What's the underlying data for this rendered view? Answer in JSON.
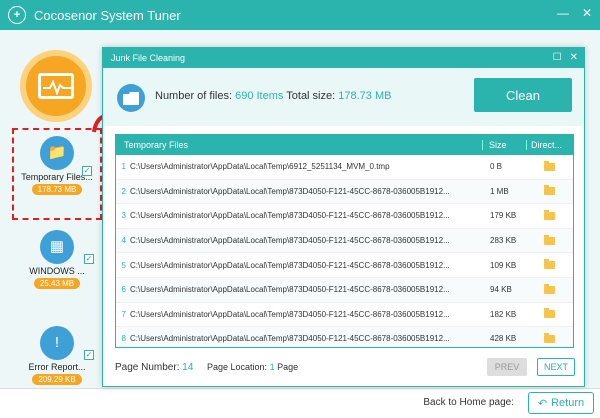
{
  "app": {
    "title": "Cocosenor System Tuner",
    "controls": [
      "minimize",
      "close"
    ]
  },
  "modules": [
    {
      "label": "Temporary Files...",
      "size": "178.73 MB",
      "selected": true,
      "icon": "folder-gear-icon"
    },
    {
      "label": "WINDOWS ...",
      "size": "25.43 MB",
      "selected": false,
      "icon": "windows-icon"
    },
    {
      "label": "Error Report...",
      "size": "209.29 KB",
      "selected": false,
      "icon": "exclamation-icon"
    }
  ],
  "dialog": {
    "title": "Junk File Cleaning",
    "files_label": "Number of files:",
    "files_value": "690 Items",
    "size_label": "Total size:",
    "size_value": "178.73 MB",
    "clean_label": "Clean",
    "columns": {
      "path": "Temporary Files",
      "size": "Size",
      "dir": "Direct..."
    },
    "rows": [
      {
        "num": "1",
        "path": "C:\\Users\\Administrator\\AppData\\Local\\Temp\\6912_5251134_MVM_0.tmp",
        "size": "0 B"
      },
      {
        "num": "2",
        "path": "C:\\Users\\Administrator\\AppData\\Local\\Temp\\873D4050-F121-45CC-8678-036005B1912...",
        "size": "1 MB"
      },
      {
        "num": "3",
        "path": "C:\\Users\\Administrator\\AppData\\Local\\Temp\\873D4050-F121-45CC-8678-036005B1912...",
        "size": "179 KB"
      },
      {
        "num": "4",
        "path": "C:\\Users\\Administrator\\AppData\\Local\\Temp\\873D4050-F121-45CC-8678-036005B1912...",
        "size": "283 KB"
      },
      {
        "num": "5",
        "path": "C:\\Users\\Administrator\\AppData\\Local\\Temp\\873D4050-F121-45CC-8678-036005B1912...",
        "size": "109 KB"
      },
      {
        "num": "6",
        "path": "C:\\Users\\Administrator\\AppData\\Local\\Temp\\873D4050-F121-45CC-8678-036005B1912...",
        "size": "94 KB"
      },
      {
        "num": "7",
        "path": "C:\\Users\\Administrator\\AppData\\Local\\Temp\\873D4050-F121-45CC-8678-036005B1912...",
        "size": "182 KB"
      },
      {
        "num": "8",
        "path": "C:\\Users\\Administrator\\AppData\\Local\\Temp\\873D4050-F121-45CC-8678-036005B1912...",
        "size": "428 KB"
      }
    ],
    "page_number_label": "Page Number:",
    "page_number_value": "14",
    "page_location_label": "Page Location:",
    "page_location_value": "1",
    "page_location_suffix": "Page",
    "prev_label": "PREV",
    "next_label": "NEXT"
  },
  "bottom": {
    "back_label": "Back to Home page:",
    "return_label": "Return"
  },
  "colors": {
    "accent": "#2bb3ad",
    "orange": "#f5a623",
    "selection": "#e02020"
  }
}
